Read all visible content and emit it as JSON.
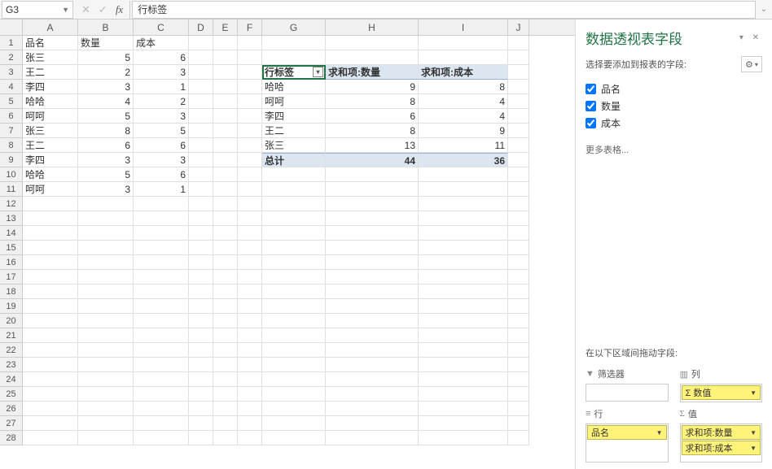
{
  "formula_bar": {
    "cell_ref": "G3",
    "formula": "行标签"
  },
  "columns": [
    "A",
    "B",
    "C",
    "D",
    "E",
    "F",
    "G",
    "H",
    "I",
    "J"
  ],
  "row_numbers": [
    1,
    2,
    3,
    4,
    5,
    6,
    7,
    8,
    9,
    10,
    11,
    12,
    13,
    14,
    15,
    16,
    17,
    18,
    19,
    20,
    21,
    22,
    23,
    24,
    25,
    26,
    27,
    28
  ],
  "source_headers": {
    "a": "品名",
    "b": "数量",
    "c": "成本"
  },
  "source_data": [
    {
      "a": "张三",
      "b": 5,
      "c": 6
    },
    {
      "a": "王二",
      "b": 2,
      "c": 3
    },
    {
      "a": "李四",
      "b": 3,
      "c": 1
    },
    {
      "a": "哈哈",
      "b": 4,
      "c": 2
    },
    {
      "a": "呵呵",
      "b": 5,
      "c": 3
    },
    {
      "a": "张三",
      "b": 8,
      "c": 5
    },
    {
      "a": "王二",
      "b": 6,
      "c": 6
    },
    {
      "a": "李四",
      "b": 3,
      "c": 3
    },
    {
      "a": "哈哈",
      "b": 5,
      "c": 6
    },
    {
      "a": "呵呵",
      "b": 3,
      "c": 1
    }
  ],
  "pivot": {
    "row_label": "行标签",
    "col1": "求和项:数量",
    "col2": "求和项:成本",
    "rows": [
      {
        "label": "哈哈",
        "v1": 9,
        "v2": 8
      },
      {
        "label": "呵呵",
        "v1": 8,
        "v2": 4
      },
      {
        "label": "李四",
        "v1": 6,
        "v2": 4
      },
      {
        "label": "王二",
        "v1": 8,
        "v2": 9
      },
      {
        "label": "张三",
        "v1": 13,
        "v2": 11
      }
    ],
    "total_label": "总计",
    "total1": 44,
    "total2": 36
  },
  "panel": {
    "title": "数据透视表字段",
    "subtitle": "选择要添加到报表的字段:",
    "fields": [
      {
        "label": "品名",
        "checked": true
      },
      {
        "label": "数量",
        "checked": true
      },
      {
        "label": "成本",
        "checked": true
      }
    ],
    "more_tables": "更多表格...",
    "drag_prompt": "在以下区域间拖动字段:",
    "areas": {
      "filter_label": "筛选器",
      "columns_label": "列",
      "columns_item": "Σ 数值",
      "rows_label": "行",
      "rows_item": "品名",
      "values_label": "值",
      "values_items": [
        "求和项:数量",
        "求和项:成本"
      ]
    }
  }
}
